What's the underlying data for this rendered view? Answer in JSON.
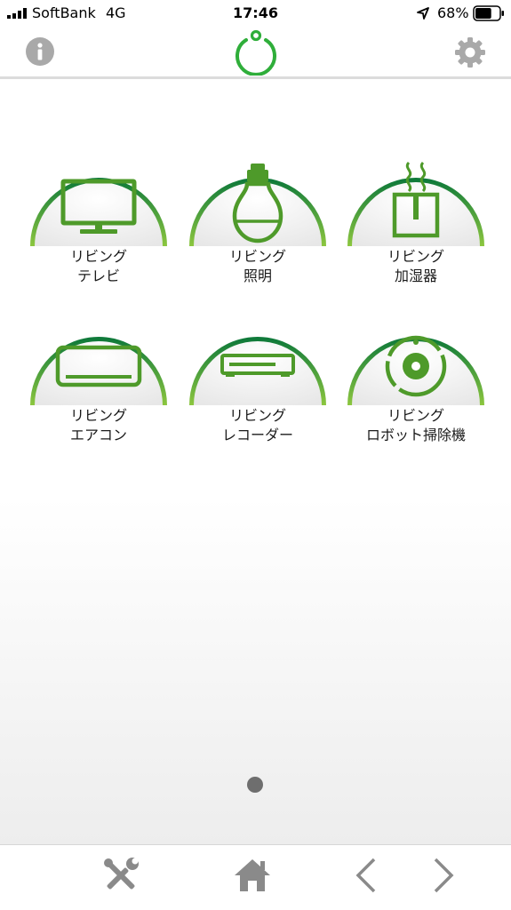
{
  "status_bar": {
    "carrier": "SoftBank",
    "network": "4G",
    "time": "17:46",
    "battery_percent": "68%",
    "battery_level": 0.68
  },
  "header": {
    "info_icon": "info-icon",
    "logo_icon": "power-logo-icon",
    "settings_icon": "gear-icon"
  },
  "colors": {
    "accent_dark": "#0f7a3a",
    "accent_light": "#8cc63f",
    "icon_green": "#4e9a2a",
    "toolbar_icon": "#8a8a8a"
  },
  "devices": [
    {
      "line1": "リビング",
      "line2": "テレビ",
      "icon": "tv-icon"
    },
    {
      "line1": "リビング",
      "line2": "照明",
      "icon": "light-bulb-icon"
    },
    {
      "line1": "リビング",
      "line2": "加湿器",
      "icon": "humidifier-icon"
    },
    {
      "line1": "リビング",
      "line2": "エアコン",
      "icon": "air-conditioner-icon"
    },
    {
      "line1": "リビング",
      "line2": "レコーダー",
      "icon": "recorder-icon"
    },
    {
      "line1": "リビング",
      "line2": "ロボット掃除機",
      "icon": "robot-vacuum-icon"
    }
  ],
  "pagination": {
    "current": 1,
    "total": 1
  },
  "toolbar": {
    "tools_icon": "tools-icon",
    "home_icon": "home-icon",
    "back_icon": "chevron-left-icon",
    "forward_icon": "chevron-right-icon"
  }
}
